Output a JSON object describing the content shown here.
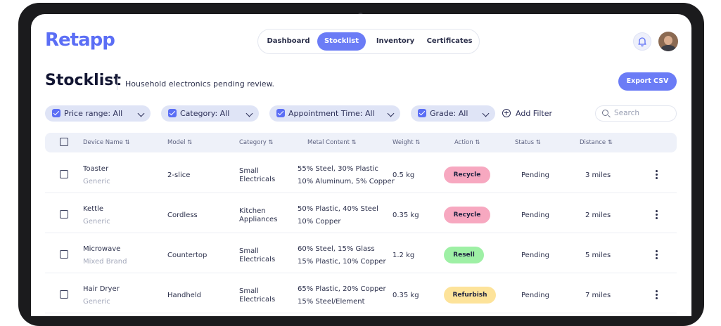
{
  "app": {
    "logo": "Retapp"
  },
  "nav": {
    "tabs": [
      {
        "label": "Dashboard",
        "active": false
      },
      {
        "label": "Stocklist",
        "active": true
      },
      {
        "label": "Inventory",
        "active": false
      },
      {
        "label": "Certificates",
        "active": false
      }
    ]
  },
  "page": {
    "title": "Stocklist",
    "subtitle": "Household electronics pending review.",
    "export_label": "Export CSV"
  },
  "filters": [
    {
      "label": "Price range: All",
      "checked": true
    },
    {
      "label": "Category: All",
      "checked": true
    },
    {
      "label": "Appointment Time: All",
      "checked": true
    },
    {
      "label": "Grade: All",
      "checked": true
    }
  ],
  "add_filter_label": "Add Filter",
  "search": {
    "placeholder": "Search"
  },
  "table": {
    "columns": [
      "Device Name",
      "Model",
      "Category",
      "Metal Content",
      "Weight",
      "Action",
      "Status",
      "Distance"
    ],
    "rows": [
      {
        "name": "Toaster",
        "brand": "Generic",
        "model": "2-slice",
        "category": [
          "Small",
          "Electricals"
        ],
        "metal": [
          "55% Steel, 30% Plastic",
          "10% Aluminum, 5% Copper"
        ],
        "weight": "0.5 kg",
        "action": "Recycle",
        "action_color": "#f7a8c0",
        "status": "Pending",
        "distance": "3 miles"
      },
      {
        "name": "Kettle",
        "brand": "Generic",
        "model": "Cordless",
        "category": [
          "Kitchen",
          "Appliances"
        ],
        "metal": [
          "50% Plastic, 40% Steel",
          "10% Copper"
        ],
        "weight": "0.35 kg",
        "action": "Recycle",
        "action_color": "#f7a8c0",
        "status": "Pending",
        "distance": "2 miles"
      },
      {
        "name": "Microwave",
        "brand": "Mixed Brand",
        "model": "Countertop",
        "category": [
          "Small",
          "Electricals"
        ],
        "metal": [
          "60% Steel, 15% Glass",
          "15% Plastic, 10% Copper"
        ],
        "weight": "1.2 kg",
        "action": "Resell",
        "action_color": "#9ef0a5",
        "status": "Pending",
        "distance": "5 miles"
      },
      {
        "name": "Hair Dryer",
        "brand": "Generic",
        "model": "Handheld",
        "category": [
          "Small",
          "Electricals"
        ],
        "metal": [
          "65% Plastic, 20% Copper",
          "15% Steel/Element"
        ],
        "weight": "0.35 kg",
        "action": "Refurbish",
        "action_color": "#fde39a",
        "status": "Pending",
        "distance": "7 miles"
      }
    ]
  }
}
